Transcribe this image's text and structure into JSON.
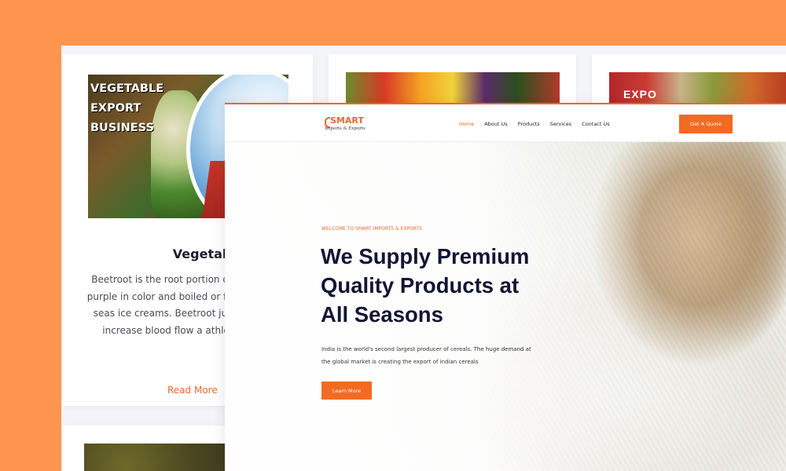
{
  "products": {
    "vegetables": {
      "image_caption": "VEGETABLE\nEXPORT\nBUSINESS",
      "heading": "Vegetables",
      "description": "Beetroot is the root portion of t They are deep purple in color and boiled or fried and used as a seas ice creams. Beetroot juice can pressure, increase blood flow a athletic performanc",
      "read_more": "Read More"
    },
    "spices": {
      "image_caption": "EXPO"
    }
  },
  "site": {
    "logo_name": "SMART",
    "logo_sub": "Imports & Exports",
    "nav": [
      "Home",
      "About Us",
      "Products",
      "Services",
      "Contact Us"
    ],
    "quote_button": "Get A Quote"
  },
  "hero": {
    "eyebrow": "WELCOME TO SMART IMPORTS & EXPORTS",
    "title": "We Supply Premium Quality Products at All Seasons",
    "text": "India is the world's second largest producer of cereals. The huge demand at the global market is creating the export of indian cereals",
    "button": "Learn More"
  },
  "colors": {
    "background": "#FD954E",
    "accent": "#F26B21",
    "heading": "#121533"
  }
}
